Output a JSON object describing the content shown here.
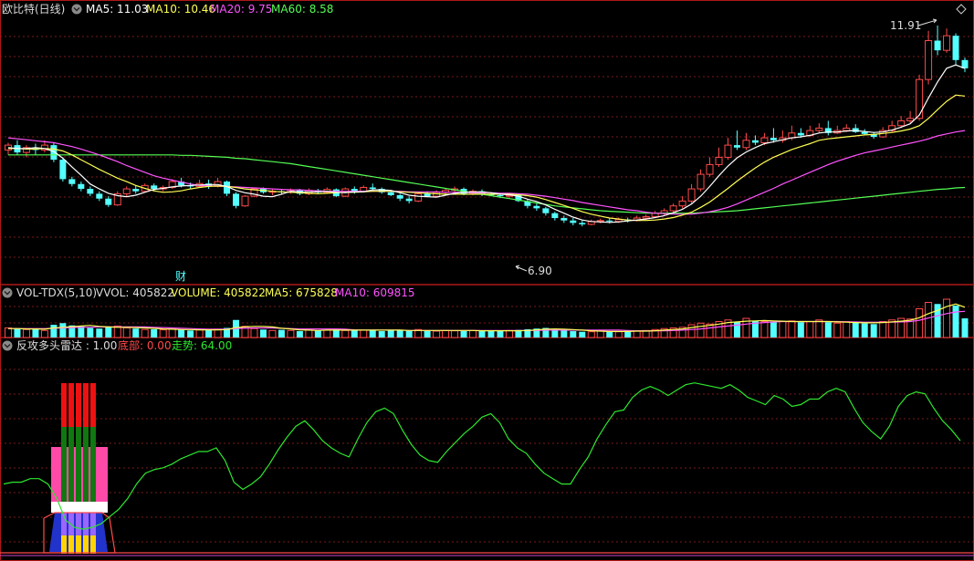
{
  "colors": {
    "bg": "#000000",
    "border": "#b01818",
    "grid": "#7a1a1a",
    "up": "#ff4a4a",
    "down": "#54ffff",
    "ma5": "#ffffff",
    "ma10": "#ffff54",
    "ma20": "#ff54ff",
    "ma60": "#54ff54",
    "green": "#2ee62e",
    "white": "#dddddd"
  },
  "icons": {
    "panel_toggle": "circle-chevron-down",
    "window_close": "diamond-outline"
  },
  "main_panel": {
    "title": "欧比特(日线)",
    "ma5_label": "MA5: 11.03",
    "ma10_label": "MA10: 10.46",
    "ma20_label": "MA20: 9.75",
    "ma60_label": "MA60: 8.58",
    "high_mark": "11.91",
    "low_mark": "6.90",
    "event_marker": "财"
  },
  "volume_panel": {
    "title": "VOL-TDX(5,10)",
    "vvol_label": "VVOL: 405822",
    "volume_label": "VOLUME: 405822",
    "ma5_label": "MA5: 675828",
    "ma10_label": "MA10: 609815"
  },
  "radar_panel": {
    "title": "反攻多头雷达 : 1.00",
    "bottom_label": "底部: 0.00",
    "trend_label": "走势: 64.00"
  },
  "chart_data": {
    "type": "candlestick",
    "price_range": [
      6.9,
      11.91
    ],
    "trend_range": [
      0,
      100
    ],
    "candles": [
      [
        9.35,
        9.45,
        9.25,
        9.5
      ],
      [
        9.45,
        9.3,
        9.25,
        9.55
      ],
      [
        9.3,
        9.4,
        9.2,
        9.45
      ],
      [
        9.4,
        9.35,
        9.25,
        9.48
      ],
      [
        9.35,
        9.45,
        9.3,
        9.55
      ],
      [
        9.45,
        9.15,
        9.1,
        9.5
      ],
      [
        9.15,
        8.75,
        8.7,
        9.2
      ],
      [
        8.75,
        8.65,
        8.6,
        8.8
      ],
      [
        8.65,
        8.55,
        8.5,
        8.7
      ],
      [
        8.55,
        8.45,
        8.4,
        8.6
      ],
      [
        8.45,
        8.35,
        8.3,
        8.5
      ],
      [
        8.35,
        8.22,
        8.18,
        8.4
      ],
      [
        8.22,
        8.45,
        8.2,
        8.5
      ],
      [
        8.45,
        8.55,
        8.4,
        8.6
      ],
      [
        8.55,
        8.5,
        8.45,
        8.62
      ],
      [
        8.5,
        8.62,
        8.48,
        8.66
      ],
      [
        8.62,
        8.55,
        8.5,
        8.66
      ],
      [
        8.55,
        8.58,
        8.5,
        8.62
      ],
      [
        8.58,
        8.7,
        8.55,
        8.75
      ],
      [
        8.7,
        8.62,
        8.58,
        8.78
      ],
      [
        8.62,
        8.6,
        8.55,
        8.68
      ],
      [
        8.6,
        8.66,
        8.58,
        8.74
      ],
      [
        8.66,
        8.6,
        8.55,
        8.74
      ],
      [
        8.6,
        8.7,
        8.58,
        8.78
      ],
      [
        8.7,
        8.45,
        8.4,
        8.72
      ],
      [
        8.45,
        8.2,
        8.15,
        8.48
      ],
      [
        8.2,
        8.4,
        8.18,
        8.42
      ],
      [
        8.4,
        8.55,
        8.38,
        8.58
      ],
      [
        8.55,
        8.48,
        8.45,
        8.58
      ],
      [
        8.48,
        8.5,
        8.42,
        8.55
      ],
      [
        8.5,
        8.48,
        8.44,
        8.54
      ],
      [
        8.48,
        8.52,
        8.45,
        8.56
      ],
      [
        8.52,
        8.45,
        8.42,
        8.55
      ],
      [
        8.45,
        8.52,
        8.42,
        8.56
      ],
      [
        8.52,
        8.48,
        8.45,
        8.55
      ],
      [
        8.48,
        8.54,
        8.45,
        8.58
      ],
      [
        8.54,
        8.4,
        8.38,
        8.56
      ],
      [
        8.4,
        8.55,
        8.38,
        8.58
      ],
      [
        8.55,
        8.5,
        8.45,
        8.6
      ],
      [
        8.5,
        8.58,
        8.48,
        8.62
      ],
      [
        8.58,
        8.55,
        8.5,
        8.66
      ],
      [
        8.55,
        8.48,
        8.45,
        8.58
      ],
      [
        8.48,
        8.42,
        8.4,
        8.52
      ],
      [
        8.42,
        8.35,
        8.3,
        8.45
      ],
      [
        8.35,
        8.3,
        8.25,
        8.4
      ],
      [
        8.3,
        8.45,
        8.28,
        8.48
      ],
      [
        8.45,
        8.4,
        8.38,
        8.5
      ],
      [
        8.4,
        8.48,
        8.38,
        8.52
      ],
      [
        8.48,
        8.52,
        8.45,
        8.56
      ],
      [
        8.52,
        8.55,
        8.48,
        8.6
      ],
      [
        8.55,
        8.45,
        8.42,
        8.58
      ],
      [
        8.45,
        8.5,
        8.42,
        8.54
      ],
      [
        8.5,
        8.44,
        8.4,
        8.54
      ],
      [
        8.44,
        8.42,
        8.4,
        8.48
      ],
      [
        8.42,
        8.4,
        8.36,
        8.46
      ],
      [
        8.4,
        8.42,
        8.36,
        8.46
      ],
      [
        8.42,
        8.3,
        8.28,
        8.45
      ],
      [
        8.3,
        8.2,
        8.15,
        8.34
      ],
      [
        8.2,
        8.15,
        8.1,
        8.25
      ],
      [
        8.15,
        8.05,
        8.0,
        8.18
      ],
      [
        8.05,
        7.95,
        7.9,
        8.08
      ],
      [
        7.95,
        7.9,
        7.85,
        8.0
      ],
      [
        7.9,
        7.85,
        7.8,
        7.95
      ],
      [
        7.85,
        7.82,
        7.78,
        7.9
      ],
      [
        7.82,
        7.88,
        7.8,
        7.92
      ],
      [
        7.88,
        7.9,
        7.84,
        7.94
      ],
      [
        7.9,
        7.88,
        7.84,
        7.94
      ],
      [
        7.88,
        7.92,
        7.85,
        7.96
      ],
      [
        7.92,
        7.9,
        7.86,
        7.96
      ],
      [
        7.9,
        7.95,
        7.88,
        8.0
      ],
      [
        7.95,
        7.98,
        7.92,
        8.02
      ],
      [
        7.98,
        8.05,
        7.95,
        8.1
      ],
      [
        8.05,
        8.1,
        8.0,
        8.15
      ],
      [
        8.1,
        8.2,
        8.05,
        8.25
      ],
      [
        8.2,
        8.3,
        8.15,
        8.4
      ],
      [
        8.3,
        8.55,
        8.25,
        8.65
      ],
      [
        8.55,
        8.85,
        8.5,
        8.95
      ],
      [
        8.85,
        9.05,
        8.8,
        9.2
      ],
      [
        9.05,
        9.2,
        9.0,
        9.4
      ],
      [
        9.2,
        9.45,
        9.15,
        9.6
      ],
      [
        9.45,
        9.4,
        9.35,
        9.75
      ],
      [
        9.4,
        9.55,
        9.35,
        9.7
      ],
      [
        9.55,
        9.5,
        9.45,
        9.65
      ],
      [
        9.5,
        9.6,
        9.45,
        9.7
      ],
      [
        9.6,
        9.55,
        9.5,
        9.8
      ],
      [
        9.55,
        9.6,
        9.5,
        9.75
      ],
      [
        9.6,
        9.7,
        9.55,
        9.85
      ],
      [
        9.7,
        9.65,
        9.6,
        9.8
      ],
      [
        9.65,
        9.75,
        9.62,
        9.85
      ],
      [
        9.75,
        9.8,
        9.7,
        9.9
      ],
      [
        9.8,
        9.7,
        9.65,
        9.95
      ],
      [
        9.7,
        9.75,
        9.68,
        9.85
      ],
      [
        9.75,
        9.8,
        9.72,
        9.88
      ],
      [
        9.8,
        9.72,
        9.7,
        9.88
      ],
      [
        9.72,
        9.68,
        9.65,
        9.78
      ],
      [
        9.68,
        9.62,
        9.58,
        9.72
      ],
      [
        9.62,
        9.75,
        9.6,
        9.82
      ],
      [
        9.75,
        9.85,
        9.72,
        9.95
      ],
      [
        9.85,
        9.95,
        9.8,
        10.05
      ],
      [
        9.95,
        10.0,
        9.9,
        10.15
      ],
      [
        10.0,
        10.8,
        9.95,
        10.9
      ],
      [
        10.8,
        11.6,
        10.7,
        11.8
      ],
      [
        11.6,
        11.4,
        11.3,
        11.91
      ],
      [
        11.4,
        11.7,
        11.35,
        11.85
      ],
      [
        11.7,
        11.2,
        11.1,
        11.75
      ],
      [
        11.2,
        11.03,
        10.95,
        11.25
      ]
    ],
    "ma5": [
      9.4,
      9.38,
      9.38,
      9.4,
      9.38,
      9.32,
      9.18,
      9.0,
      8.83,
      8.65,
      8.55,
      8.46,
      8.41,
      8.39,
      8.42,
      8.48,
      8.54,
      8.56,
      8.59,
      8.61,
      8.62,
      8.63,
      8.64,
      8.64,
      8.6,
      8.52,
      8.47,
      8.44,
      8.4,
      8.39,
      8.44,
      8.5,
      8.49,
      8.49,
      8.49,
      8.5,
      8.48,
      8.47,
      8.49,
      8.49,
      8.53,
      8.53,
      8.52,
      8.47,
      8.42,
      8.4,
      8.39,
      8.38,
      8.42,
      8.46,
      8.48,
      8.49,
      8.49,
      8.47,
      8.44,
      8.43,
      8.4,
      8.34,
      8.29,
      8.22,
      8.13,
      8.05,
      7.97,
      7.91,
      7.88,
      7.87,
      7.86,
      7.87,
      7.89,
      7.91,
      7.93,
      7.96,
      8.0,
      8.06,
      8.13,
      8.24,
      8.4,
      8.6,
      8.82,
      9.02,
      9.19,
      9.31,
      9.4,
      9.48,
      9.52,
      9.56,
      9.6,
      9.62,
      9.65,
      9.7,
      9.72,
      9.72,
      9.74,
      9.75,
      9.73,
      9.71,
      9.72,
      9.76,
      9.82,
      9.89,
      10.07,
      10.42,
      10.75,
      11.03,
      11.1,
      11.03
    ],
    "ma10": [
      9.38,
      9.38,
      9.37,
      9.37,
      9.38,
      9.37,
      9.33,
      9.25,
      9.15,
      9.05,
      8.95,
      8.86,
      8.77,
      8.7,
      8.62,
      8.56,
      8.51,
      8.48,
      8.49,
      8.51,
      8.55,
      8.58,
      8.6,
      8.61,
      8.6,
      8.58,
      8.55,
      8.53,
      8.52,
      8.5,
      8.49,
      8.48,
      8.47,
      8.46,
      8.45,
      8.46,
      8.47,
      8.48,
      8.48,
      8.49,
      8.5,
      8.5,
      8.5,
      8.49,
      8.48,
      8.47,
      8.46,
      8.45,
      8.44,
      8.44,
      8.44,
      8.44,
      8.44,
      8.44,
      8.44,
      8.44,
      8.43,
      8.41,
      8.38,
      8.33,
      8.27,
      8.21,
      8.15,
      8.08,
      8.03,
      7.99,
      7.95,
      7.93,
      7.91,
      7.9,
      7.9,
      7.91,
      7.93,
      7.96,
      8.01,
      8.07,
      8.17,
      8.28,
      8.42,
      8.56,
      8.71,
      8.85,
      8.98,
      9.1,
      9.2,
      9.28,
      9.36,
      9.42,
      9.48,
      9.55,
      9.58,
      9.6,
      9.62,
      9.64,
      9.66,
      9.67,
      9.69,
      9.71,
      9.74,
      9.78,
      9.85,
      10.0,
      10.18,
      10.35,
      10.48,
      10.46
    ],
    "ma20": [
      9.6,
      9.58,
      9.56,
      9.54,
      9.52,
      9.5,
      9.46,
      9.42,
      9.37,
      9.31,
      9.25,
      9.18,
      9.11,
      9.03,
      8.96,
      8.89,
      8.82,
      8.77,
      8.73,
      8.69,
      8.65,
      8.62,
      8.61,
      8.61,
      8.6,
      8.59,
      8.58,
      8.57,
      8.56,
      8.55,
      8.54,
      8.53,
      8.53,
      8.52,
      8.51,
      8.5,
      8.5,
      8.5,
      8.5,
      8.5,
      8.5,
      8.5,
      8.5,
      8.5,
      8.49,
      8.49,
      8.49,
      8.49,
      8.48,
      8.48,
      8.48,
      8.47,
      8.47,
      8.47,
      8.46,
      8.46,
      8.45,
      8.44,
      8.42,
      8.4,
      8.37,
      8.34,
      8.31,
      8.27,
      8.24,
      8.21,
      8.18,
      8.15,
      8.12,
      8.1,
      8.07,
      8.05,
      8.04,
      8.03,
      8.03,
      8.03,
      8.05,
      8.08,
      8.12,
      8.17,
      8.24,
      8.32,
      8.4,
      8.48,
      8.56,
      8.65,
      8.73,
      8.81,
      8.89,
      8.97,
      9.05,
      9.12,
      9.18,
      9.24,
      9.29,
      9.33,
      9.37,
      9.41,
      9.45,
      9.49,
      9.53,
      9.58,
      9.64,
      9.68,
      9.72,
      9.75
    ],
    "ma60": [
      9.25,
      9.25,
      9.25,
      9.25,
      9.25,
      9.25,
      9.25,
      9.25,
      9.25,
      9.25,
      9.25,
      9.25,
      9.25,
      9.25,
      9.25,
      9.25,
      9.25,
      9.25,
      9.25,
      9.24,
      9.24,
      9.23,
      9.22,
      9.21,
      9.2,
      9.18,
      9.17,
      9.15,
      9.13,
      9.11,
      9.09,
      9.07,
      9.04,
      9.01,
      8.98,
      8.95,
      8.92,
      8.89,
      8.86,
      8.83,
      8.8,
      8.77,
      8.74,
      8.71,
      8.68,
      8.65,
      8.62,
      8.59,
      8.56,
      8.53,
      8.5,
      8.47,
      8.44,
      8.41,
      8.38,
      8.35,
      8.32,
      8.29,
      8.26,
      8.23,
      8.2,
      8.18,
      8.16,
      8.14,
      8.12,
      8.1,
      8.09,
      8.08,
      8.07,
      8.06,
      8.05,
      8.05,
      8.05,
      8.05,
      8.05,
      8.05,
      8.06,
      8.07,
      8.08,
      8.09,
      8.1,
      8.12,
      8.14,
      8.16,
      8.18,
      8.2,
      8.22,
      8.24,
      8.26,
      8.28,
      8.3,
      8.32,
      8.34,
      8.36,
      8.38,
      8.4,
      8.42,
      8.44,
      8.46,
      8.48,
      8.5,
      8.52,
      8.54,
      8.55,
      8.57,
      8.58
    ],
    "volume": [
      30,
      28,
      25,
      26,
      22,
      40,
      45,
      38,
      35,
      30,
      28,
      33,
      36,
      30,
      28,
      25,
      26,
      24,
      27,
      25,
      22,
      24,
      23,
      26,
      30,
      55,
      35,
      28,
      25,
      22,
      24,
      22,
      20,
      24,
      22,
      23,
      25,
      22,
      24,
      23,
      22,
      20,
      22,
      24,
      22,
      25,
      22,
      20,
      22,
      21,
      20,
      22,
      20,
      21,
      20,
      22,
      24,
      26,
      28,
      30,
      25,
      22,
      20,
      18,
      18,
      20,
      20,
      18,
      22,
      20,
      22,
      25,
      28,
      30,
      32,
      40,
      45,
      42,
      50,
      55,
      48,
      60,
      52,
      50,
      48,
      50,
      52,
      48,
      50,
      55,
      48,
      45,
      50,
      46,
      44,
      42,
      50,
      55,
      60,
      58,
      90,
      110,
      105,
      120,
      100,
      60
    ],
    "vol_ma5": [
      28,
      28,
      27,
      27,
      26,
      30,
      32,
      34,
      36,
      38,
      35,
      33,
      32,
      32,
      31,
      30,
      29,
      27,
      26,
      25,
      25,
      24,
      24,
      24,
      25,
      31,
      33,
      35,
      35,
      33,
      29,
      27,
      24,
      23,
      22,
      23,
      23,
      23,
      23,
      23,
      23,
      23,
      23,
      23,
      22,
      22,
      22,
      22,
      22,
      22,
      22,
      22,
      21,
      21,
      21,
      21,
      21,
      22,
      24,
      26,
      27,
      26,
      25,
      23,
      21,
      20,
      19,
      19,
      19,
      20,
      20,
      21,
      23,
      25,
      27,
      31,
      35,
      38,
      42,
      47,
      49,
      51,
      52,
      53,
      52,
      51,
      50,
      50,
      50,
      50,
      50,
      49,
      48,
      47,
      46,
      46,
      47,
      49,
      51,
      54,
      62,
      75,
      85,
      97,
      105,
      95
    ],
    "vol_ma10": [
      28,
      28,
      28,
      28,
      28,
      29,
      30,
      31,
      32,
      32,
      33,
      33,
      33,
      33,
      33,
      33,
      32,
      31,
      30,
      29,
      28,
      27,
      26,
      26,
      26,
      28,
      29,
      30,
      30,
      30,
      29,
      28,
      27,
      27,
      27,
      27,
      27,
      26,
      24,
      23,
      23,
      23,
      23,
      23,
      22,
      22,
      22,
      22,
      22,
      22,
      22,
      22,
      22,
      22,
      22,
      22,
      22,
      22,
      22,
      23,
      23,
      23,
      23,
      23,
      23,
      23,
      23,
      23,
      22,
      21,
      21,
      21,
      21,
      22,
      23,
      25,
      27,
      30,
      33,
      36,
      39,
      42,
      45,
      47,
      49,
      50,
      50,
      50,
      50,
      50,
      50,
      50,
      49,
      49,
      48,
      48,
      48,
      48,
      49,
      50,
      54,
      61,
      68,
      75,
      80,
      82
    ],
    "trend": [
      30,
      31,
      31,
      33,
      33,
      30,
      22,
      10,
      6,
      5,
      6,
      8,
      12,
      16,
      22,
      30,
      36,
      38,
      39,
      41,
      44,
      46,
      48,
      48,
      50,
      43,
      31,
      27,
      30,
      34,
      41,
      49,
      56,
      62,
      65,
      60,
      54,
      50,
      47,
      45,
      55,
      64,
      70,
      72,
      69,
      60,
      52,
      46,
      43,
      42,
      48,
      53,
      58,
      62,
      67,
      69,
      64,
      55,
      50,
      47,
      41,
      36,
      33,
      30,
      30,
      38,
      45,
      55,
      63,
      70,
      71,
      78,
      82,
      84,
      82,
      79,
      82,
      85,
      86,
      85,
      84,
      83,
      85,
      82,
      78,
      76,
      74,
      79,
      77,
      73,
      74,
      77,
      77,
      81,
      83,
      81,
      72,
      64,
      59,
      55,
      62,
      73,
      79,
      81,
      80,
      72,
      65,
      60,
      54
    ]
  }
}
